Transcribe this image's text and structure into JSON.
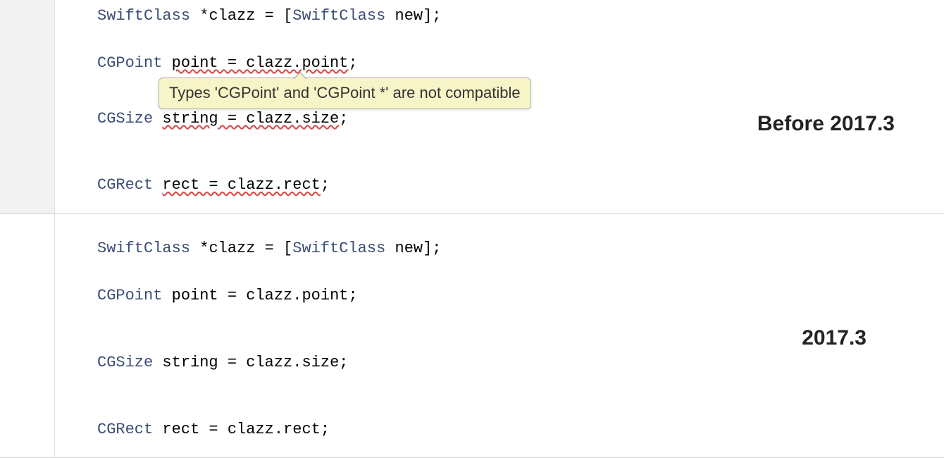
{
  "panels": {
    "before": {
      "label": "Before 2017.3",
      "tooltip": "Types 'CGPoint' and 'CGPoint *' are not compatible",
      "line1": {
        "type1": "SwiftClass",
        "op1": " *",
        "ident1": "clazz",
        "op2": " = [",
        "type2": "SwiftClass",
        "ident2": " new",
        "op3": "];"
      },
      "line2": {
        "type1": "CGPoint",
        "err1": "point = clazz.point",
        "op1": ";"
      },
      "line3": {
        "type1": "CGSize",
        "err1": "string = clazz.size",
        "op1": ";"
      },
      "line4": {
        "type1": "CGRect",
        "err1": "rect = clazz.rect",
        "op1": ";"
      }
    },
    "after": {
      "label": "2017.3",
      "line1": {
        "type1": "SwiftClass",
        "op1": " *",
        "ident1": "clazz",
        "op2": " = [",
        "type2": "SwiftClass",
        "ident2": " new",
        "op3": "];"
      },
      "line2": {
        "type1": "CGPoint",
        "ident1": " point",
        "op1": " = ",
        "ident2": "clazz",
        "op2": ".",
        "ident3": "point",
        "op3": ";"
      },
      "line3": {
        "type1": "CGSize",
        "ident1": " string",
        "op1": " = ",
        "ident2": "clazz",
        "op2": ".",
        "ident3": "size",
        "op3": ";"
      },
      "line4": {
        "type1": "CGRect",
        "ident1": " rect",
        "op1": " = ",
        "ident2": "clazz",
        "op2": ".",
        "ident3": "rect",
        "op3": ";"
      }
    }
  }
}
